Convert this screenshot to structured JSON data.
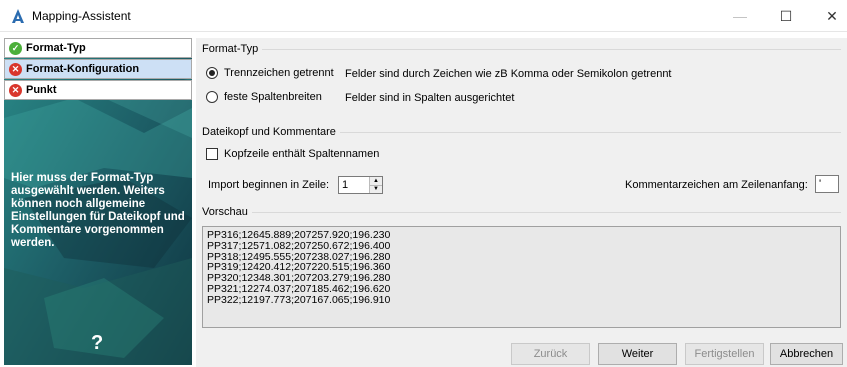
{
  "window": {
    "title": "Mapping-Assistent",
    "minimize_label": "—",
    "maximize_label": "☐",
    "close_label": "✕"
  },
  "sidebar": {
    "steps": [
      {
        "label": "Format-Typ",
        "status": "ok",
        "status_icon": "✓",
        "selected": false
      },
      {
        "label": "Format-Konfiguration",
        "status": "error",
        "status_icon": "✕",
        "selected": true
      },
      {
        "label": "Punkt",
        "status": "error",
        "status_icon": "✕",
        "selected": false
      }
    ],
    "help_text": "Hier muss der Format-Typ ausgewählt werden. Weiters können noch allgemeine Einstellungen für Dateikopf und Kommentare vorgenommen werden.",
    "help_symbol": "?"
  },
  "format_type": {
    "legend": "Format-Typ",
    "options": [
      {
        "label": "Trennzeichen getrennt",
        "description": "Felder sind durch Zeichen wie zB Komma oder Semikolon getrennt",
        "checked": true
      },
      {
        "label": "feste Spaltenbreiten",
        "description": "Felder sind in Spalten ausgerichtet",
        "checked": false
      }
    ]
  },
  "header_section": {
    "legend": "Dateikopf und Kommentare",
    "header_checkbox_label": "Kopfzeile enthält Spaltennamen",
    "header_checked": false,
    "import_start_label": "Import beginnen in Zeile:",
    "import_start_value": "1",
    "comment_char_label": "Kommentarzeichen am Zeilenanfang:",
    "comment_char_value": "'"
  },
  "preview": {
    "legend": "Vorschau",
    "lines": [
      "PP316;12645.889;207257.920;196.230",
      "PP317;12571.082;207250.672;196.400",
      "PP318;12495.555;207238.027;196.280",
      "PP319;12420.412;207220.515;196.360",
      "PP320;12348.301;207203.279;196.280",
      "PP321;12274.037;207185.462;196.620",
      "PP322;12197.773;207167.065;196.910"
    ]
  },
  "buttons": {
    "back": "Zurück",
    "next": "Weiter",
    "finish": "Fertigstellen",
    "cancel": "Abbrechen"
  },
  "colors": {
    "accent_blue": "#2b6cb0",
    "sidebar_bg": "#1a4d58",
    "selected_step_bg": "#cde0f5",
    "ok": "#4caf3a",
    "error": "#d9362c"
  }
}
